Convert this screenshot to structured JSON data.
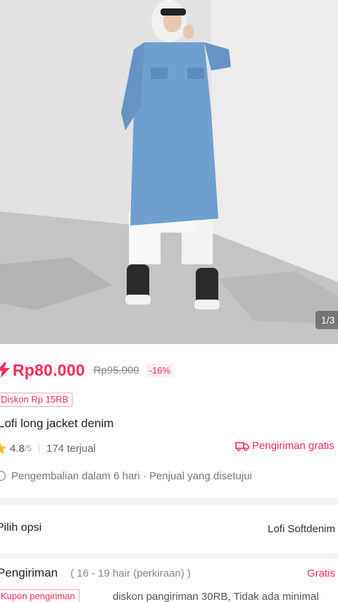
{
  "gallery": {
    "page_indicator": "1/3"
  },
  "price": {
    "current": "Rp80.000",
    "original": "Rp95.000",
    "discount_percent": "-16%",
    "accent_color": "#fe2c55"
  },
  "discount_badge": "Diskon Rp 15RB",
  "product": {
    "title": "Lofi long jacket denim"
  },
  "rating": {
    "value": "4.8",
    "max": "/5",
    "sold": "174 terjual",
    "star_icon": "star-icon"
  },
  "shipping_badge": {
    "label": "Pengiriman gratis",
    "icon": "truck-icon"
  },
  "returns": {
    "text": "Pengembalian dalam 6 hari · Penjual yang disetujui",
    "icon": "return-icon"
  },
  "options": {
    "label": "Pilih opsi",
    "value": "Lofi Softdenim"
  },
  "delivery": {
    "label": "Pengiriman",
    "estimate": "( 16 - 19 hair (perkiraan) )",
    "price": "Gratis"
  },
  "coupon": {
    "badge": "Kupon pengiriman",
    "text": "diskon pangiriman 30RB, Tidak ada minimal"
  }
}
